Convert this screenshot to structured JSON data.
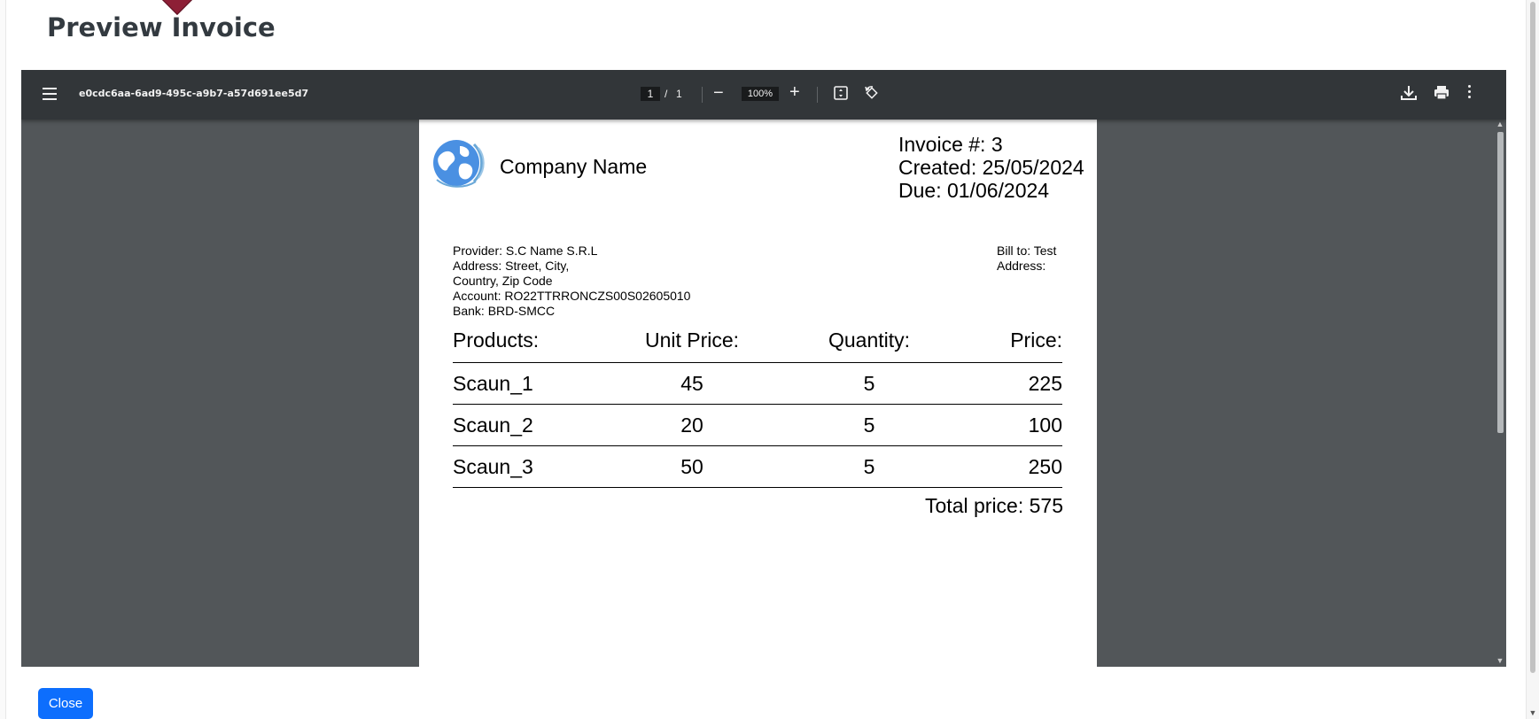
{
  "modal": {
    "title": "Preview Invoice",
    "close_label": "Close"
  },
  "viewer": {
    "file_name": "e0cdc6aa-6ad9-495c-a9b7-a57d691ee5d7",
    "current_page": "1",
    "page_separator": "/",
    "total_pages": "1",
    "zoom_out_label": "−",
    "zoom_level": "100%",
    "zoom_in_label": "+"
  },
  "invoice": {
    "company_name": "Company Name",
    "invoice_number": "Invoice #: 3",
    "created": "Created: 25/05/2024",
    "due": "Due: 01/06/2024",
    "provider": {
      "name": "Provider: S.C Name S.R.L",
      "address": "Address: Street, City,",
      "country": "Country, Zip Code",
      "account": "Account: RO22TTRRONCZS00S02605010",
      "bank": "Bank: BRD-SMCC"
    },
    "bill_to": {
      "name": "Bill to: Test",
      "address": "Address:"
    },
    "columns": [
      "Products:",
      "Unit Price:",
      "Quantity:",
      "Price:"
    ],
    "rows": [
      [
        "Scaun_1",
        "45",
        "5",
        "225"
      ],
      [
        "Scaun_2",
        "20",
        "5",
        "100"
      ],
      [
        "Scaun_3",
        "50",
        "5",
        "250"
      ]
    ],
    "total": "Total price: 575"
  },
  "colors": {
    "toolbar": "#323639",
    "viewer_background": "#525659",
    "primary_button": "#0d6efd",
    "marker": "#8d1f36",
    "logo_globe": "#4a90e2"
  }
}
